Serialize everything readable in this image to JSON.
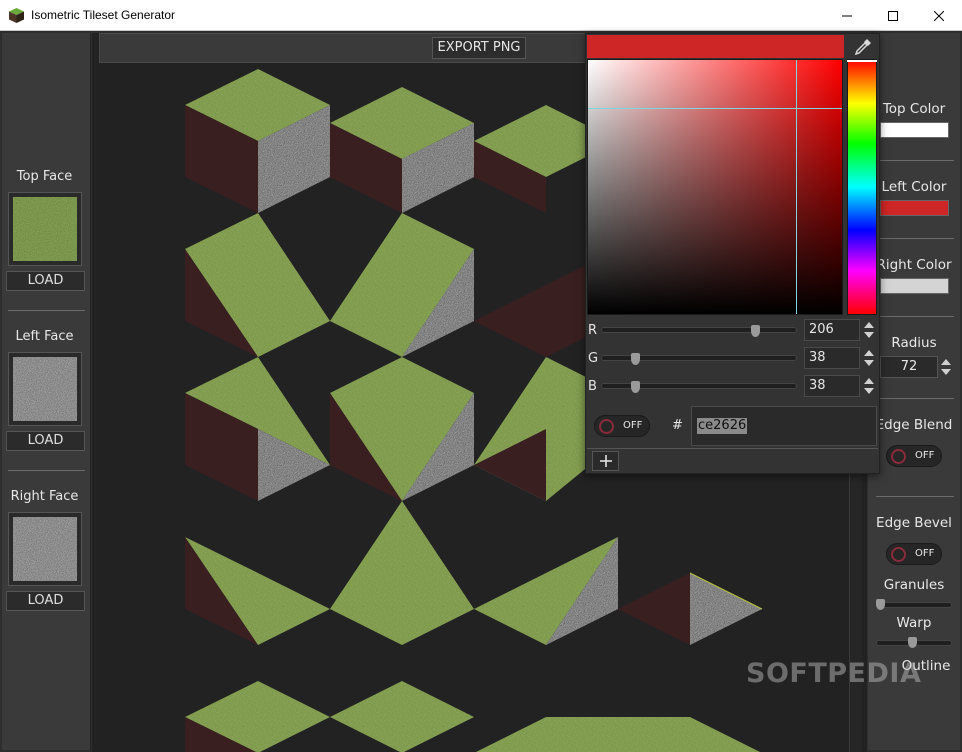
{
  "window": {
    "title": "Isometric Tileset Generator",
    "app_icon": "green-cube-icon",
    "controls": [
      "minimize-icon",
      "maximize-icon",
      "close-icon"
    ]
  },
  "left_panel": {
    "faces": [
      {
        "label": "Top Face",
        "button": "LOAD",
        "texture": "grass"
      },
      {
        "label": "Left Face",
        "button": "LOAD",
        "texture": "stone"
      },
      {
        "label": "Right Face",
        "button": "LOAD",
        "texture": "stone"
      }
    ]
  },
  "toolbar": {
    "export_label": "EXPORT PNG"
  },
  "color_picker": {
    "color_hex": "#ce2626",
    "channels": [
      {
        "label": "R",
        "value": "206"
      },
      {
        "label": "G",
        "value": "38"
      },
      {
        "label": "B",
        "value": "38"
      }
    ],
    "raw_toggle": "OFF",
    "hash_label": "#",
    "hex_value": "ce2626",
    "eyedropper_icon": "eyedropper-icon",
    "add_icon": "plus-icon"
  },
  "right_panel": {
    "top_color_label": "Top Color",
    "top_color": "#ffffff",
    "left_color_label": "Left Color",
    "left_color": "#ce2626",
    "right_color_label": "Right Color",
    "right_color": "#d4d4d4",
    "radius_label": "Radius",
    "radius_value": "72",
    "edge_blend_label": "Edge Blend",
    "edge_blend_state": "OFF",
    "edge_bevel_label": "Edge Bevel",
    "edge_bevel_state": "OFF",
    "granules_label": "Granules",
    "granules_level": 0.0,
    "warp_label": "Warp",
    "warp_level": 0.5,
    "outline_label": "Outline"
  },
  "watermark": "SOFTPEDIA",
  "colors": {
    "grass": "#6f8f3a",
    "dark_red": "#3a1f20",
    "stone": "#4a4a4a",
    "background": "#2e2e2e",
    "canvas": "#222222"
  }
}
